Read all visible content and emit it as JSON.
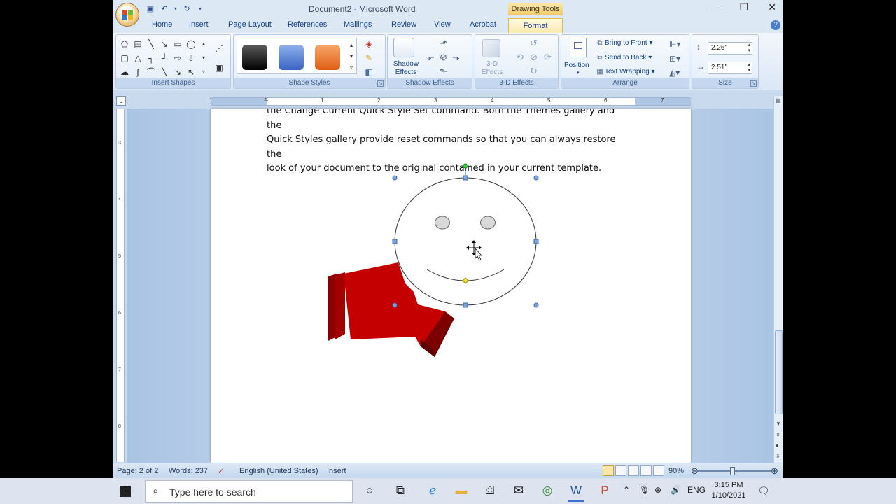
{
  "window": {
    "title": "Document2 - Microsoft Word",
    "contextual_tab_group": "Drawing Tools",
    "controls": {
      "minimize": "—",
      "maximize": "❐",
      "close": "✕"
    }
  },
  "ribbon_tabs": [
    "Home",
    "Insert",
    "Page Layout",
    "References",
    "Mailings",
    "Review",
    "View",
    "Acrobat",
    "Format"
  ],
  "active_tab": "Format",
  "groups": {
    "insert_shapes": "Insert Shapes",
    "shape_styles": "Shape Styles",
    "shadow_effects": "Shadow Effects",
    "three_d_effects": "3-D Effects",
    "arrange": "Arrange",
    "size": "Size"
  },
  "buttons": {
    "shadow_effects": "Shadow Effects",
    "three_d_effects": "3-D Effects",
    "position": "Position",
    "bring_to_front": "Bring to Front",
    "send_to_back": "Send to Back",
    "text_wrapping": "Text Wrapping"
  },
  "size": {
    "height": "2.26\"",
    "width": "2.51\""
  },
  "shape_style_colors": [
    "#1a1a1a",
    "#4f7fd4",
    "#e8732e"
  ],
  "ruler_numbers": [
    "1",
    "1",
    "2",
    "3",
    "4",
    "5",
    "6",
    "7"
  ],
  "vruler_numbers": [
    "3",
    "4",
    "5",
    "6",
    "7",
    "8"
  ],
  "document": {
    "lines": [
      "the Change Current Quick Style Set command. Both the Themes gallery and the",
      "Quick Styles gallery provide reset commands so that you can always restore the",
      "look of your document to the original contained in your current template."
    ]
  },
  "status": {
    "page": "Page: 2 of 2",
    "words": "Words: 237",
    "language": "English (United States)",
    "mode": "Insert",
    "zoom": "90%"
  },
  "taskbar": {
    "search_placeholder": "Type here to search",
    "time": "3:15 PM",
    "date": "1/10/2021",
    "lang": "ENG"
  }
}
